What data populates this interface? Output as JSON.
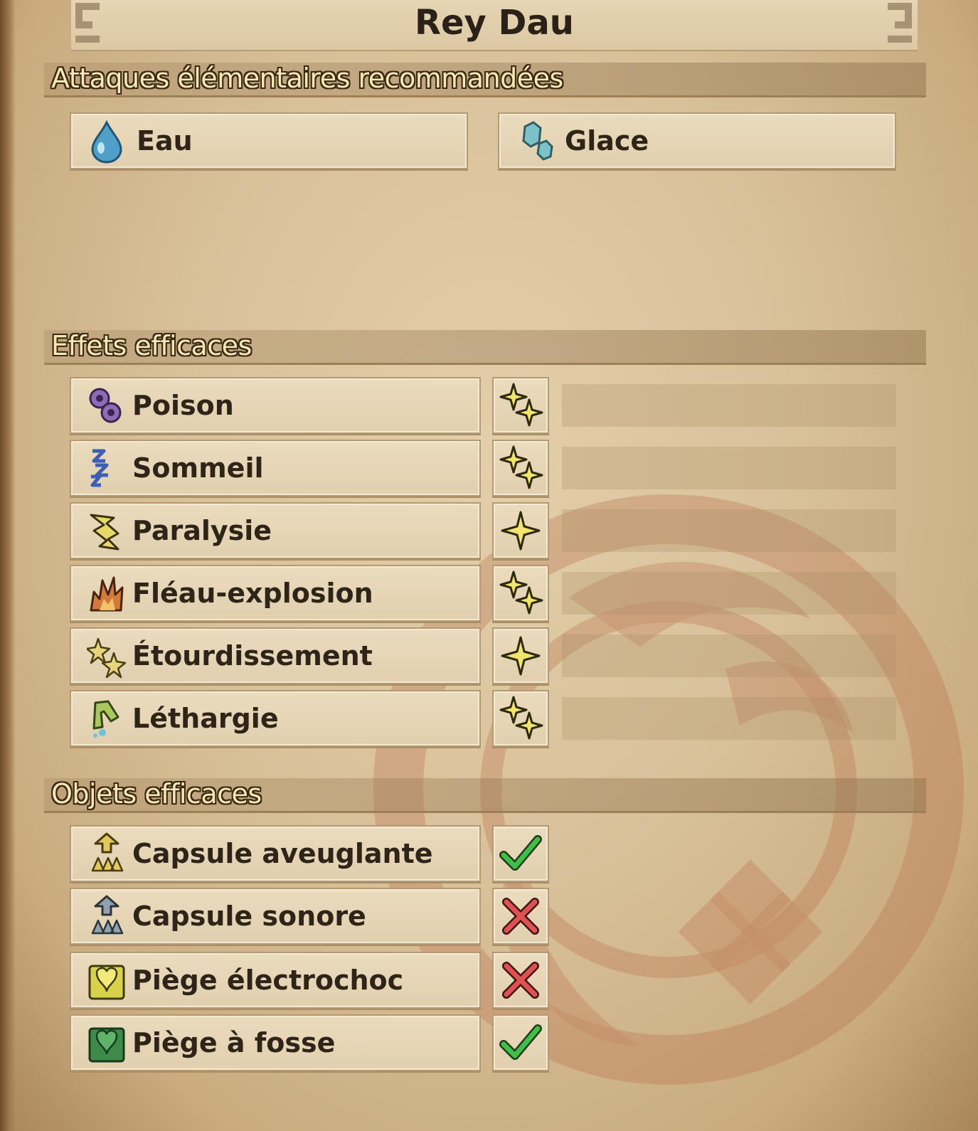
{
  "title": "Rey Dau",
  "sections": {
    "elemental": {
      "title": "Attaques élémentaires recommandées",
      "items": [
        {
          "label": "Eau",
          "icon": "water-drop-icon"
        },
        {
          "label": "Glace",
          "icon": "ice-crystal-icon"
        }
      ]
    },
    "effects": {
      "title": "Effets efficaces",
      "items": [
        {
          "label": "Poison",
          "icon": "poison-icon",
          "rating": 2,
          "mark": "two-stars-icon"
        },
        {
          "label": "Sommeil",
          "icon": "sleep-icon",
          "rating": 2,
          "mark": "two-stars-icon"
        },
        {
          "label": "Paralysie",
          "icon": "paralysis-icon",
          "rating": 1,
          "mark": "one-star-icon"
        },
        {
          "label": "Fléau-explosion",
          "icon": "blast-icon",
          "rating": 2,
          "mark": "two-stars-icon"
        },
        {
          "label": "Étourdissement",
          "icon": "stun-icon",
          "rating": 1,
          "mark": "one-star-icon"
        },
        {
          "label": "Léthargie",
          "icon": "exhaust-icon",
          "rating": 2,
          "mark": "two-stars-icon"
        }
      ]
    },
    "items": {
      "title": "Objets efficaces",
      "items": [
        {
          "label": "Capsule aveuglante",
          "icon": "flash-pod-icon",
          "effective": true,
          "mark": "check-icon"
        },
        {
          "label": "Capsule sonore",
          "icon": "sonic-pod-icon",
          "effective": false,
          "mark": "cross-icon"
        },
        {
          "label": "Piège électrochoc",
          "icon": "shock-trap-icon",
          "effective": false,
          "mark": "cross-icon"
        },
        {
          "label": "Piège à fosse",
          "icon": "pitfall-trap-icon",
          "effective": true,
          "mark": "check-icon"
        }
      ]
    }
  },
  "colors": {
    "parchment": "#d8c19a",
    "section_title": "#f6e7b3",
    "star": "#f1e56b",
    "check": "#3fbf4a",
    "cross": "#e05252"
  }
}
